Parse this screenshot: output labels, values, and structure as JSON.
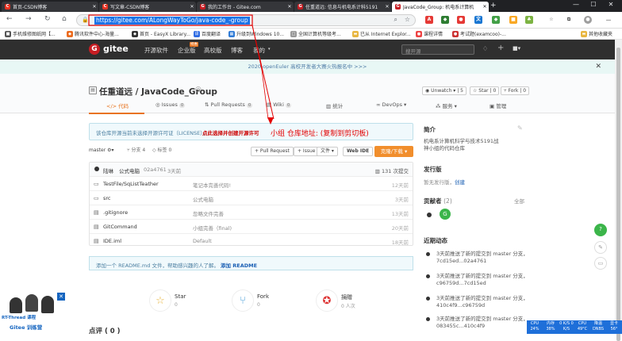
{
  "browser": {
    "tabs": [
      {
        "title": "首页-CSDN博客",
        "color": "#e73323",
        "icon": "C"
      },
      {
        "title": "写文章-CSDN博客",
        "color": "#e73323",
        "icon": "C"
      },
      {
        "title": "我的工作台 - Gitee.com",
        "color": "#c71d23",
        "icon": "G"
      },
      {
        "title": "任重道远: 信息与机电系计科5191",
        "color": "#c71d23",
        "icon": "G"
      },
      {
        "title": "JavaCode_Group: 机电系计算机",
        "color": "#c71d23",
        "icon": "G",
        "active": true
      }
    ],
    "url": "https://gitee.com/ALongWayToGo/java-code_-group",
    "bookmarks": [
      {
        "label": "手机维修图纸网【...",
        "color": "#555"
      },
      {
        "label": "腾讯软件中心-海量...",
        "color": "#ec6c1f"
      },
      {
        "label": "首页 - EasyX Library...",
        "color": "#333"
      },
      {
        "label": "百度翻译",
        "color": "#2d6be4"
      },
      {
        "label": "升级到Windows 10...",
        "color": "#2f7bd6"
      },
      {
        "label": "全国计算机等级考...",
        "color": "#666"
      },
      {
        "label": "已从 Internet Explor...",
        "color": "#e8b640"
      },
      {
        "label": "课程详情",
        "color": "#e44"
      },
      {
        "label": "考试题(examcoo)-...",
        "color": "#c33"
      },
      {
        "label": "其他收藏夹",
        "color": "#e8b640"
      }
    ]
  },
  "gitee_nav": {
    "logo": "gitee",
    "items": [
      "开源软件",
      "企业版",
      "高校版",
      "博客",
      "我的"
    ],
    "enterprise_badge": "特惠",
    "search_placeholder": "搜开源"
  },
  "banner": {
    "text": "2020 openEuler 高校开发者大赛火热报名中 >>>",
    "close": "✕"
  },
  "repo": {
    "owner": "任重道远",
    "name": "JavaCode_Group",
    "title": "任重道远 / JavaCode_Group",
    "unwatch": "Unwatch",
    "watch_count": "5",
    "star": "Star",
    "star_count": "0",
    "fork": "Fork",
    "fork_count": "0",
    "tabs": [
      {
        "label": "代码",
        "count": ""
      },
      {
        "label": "Issues",
        "count": "0"
      },
      {
        "label": "Pull Requests",
        "count": "0"
      },
      {
        "label": "Wiki",
        "count": "0"
      },
      {
        "label": "统计",
        "count": ""
      },
      {
        "label": "DevOps",
        "count": ""
      },
      {
        "label": "服务",
        "count": ""
      },
      {
        "label": "管理",
        "count": ""
      }
    ]
  },
  "hint": {
    "text": "该仓库开源当前未选择开源许可证（LICENSE），",
    "link": "点此选择并创建开源许可",
    "annotation": "小组 仓库地址: (复制到剪切板)"
  },
  "branch_row": {
    "branch": "master",
    "branches": "分支 4",
    "tags": "标签 0",
    "pull_request": "+ Pull Request",
    "issue": "+ Issue",
    "file": "文件",
    "webide": "Web IDE",
    "download": "克隆/下载"
  },
  "commit": {
    "author": "陆琳",
    "message": "公式电脑",
    "hash": "02a4761",
    "time": "3天前",
    "total": "131 次提交"
  },
  "files": [
    {
      "icon": "folder",
      "name": "TestFile/SqListTeather",
      "message": "笔记本完善代码!",
      "time": "12天前"
    },
    {
      "icon": "folder",
      "name": "src",
      "message": "公式电脑",
      "time": "3天前"
    },
    {
      "icon": "file",
      "name": ".gitignore",
      "message": "忽略文件完善",
      "time": "13天前"
    },
    {
      "icon": "file",
      "name": "GitCommand",
      "message": "小组完善（final)",
      "time": "20天前"
    },
    {
      "icon": "file",
      "name": "IDE.iml",
      "message": "Default",
      "time": "18天前"
    }
  ],
  "readme": {
    "text": "添加一个 README.md 文件，帮助感兴趣的人了解。",
    "link": "添加 README"
  },
  "stats": [
    {
      "label": "Star",
      "value": "0",
      "icon": "☆",
      "color": "#e8b640"
    },
    {
      "label": "Fork",
      "value": "0",
      "icon": "⑂",
      "color": "#4a9fd8"
    },
    {
      "label": "捐赠",
      "value": "0 人次",
      "icon": "✪",
      "color": "#d33"
    }
  ],
  "comments_head": "点评 ( 0 )",
  "sidebar": {
    "intro_head": "简介",
    "intro_text": "机电系计算机科学与技术5191战神小组的代码仓库",
    "release_head": "发行版",
    "release_text": "暂无发行版，",
    "release_link": "创建",
    "contrib_head": "贡献者",
    "contrib_count": "(2)",
    "contrib_all": "全部",
    "activity_head": "近期动态",
    "activities": [
      "3天前推送了新的提交到 master 分支，7cd15ed...02a4761",
      "3天前推送了新的提交到 master 分支，c96759d...7cd15ed",
      "3天前推送了新的提交到 master 分支，410c4f9...c96759d",
      "3天前推送了新的提交到 master 分支，083455c...410c4f9"
    ]
  },
  "promo": {
    "line1": "RT-Thread 课程",
    "line2": "Gitee 训练营"
  },
  "cpu_widget": [
    "CPU 24%",
    "内存 38%",
    "0 K/S 0 K/S",
    "CPU 49°C",
    "降温 DNBS",
    "显卡 56°"
  ]
}
